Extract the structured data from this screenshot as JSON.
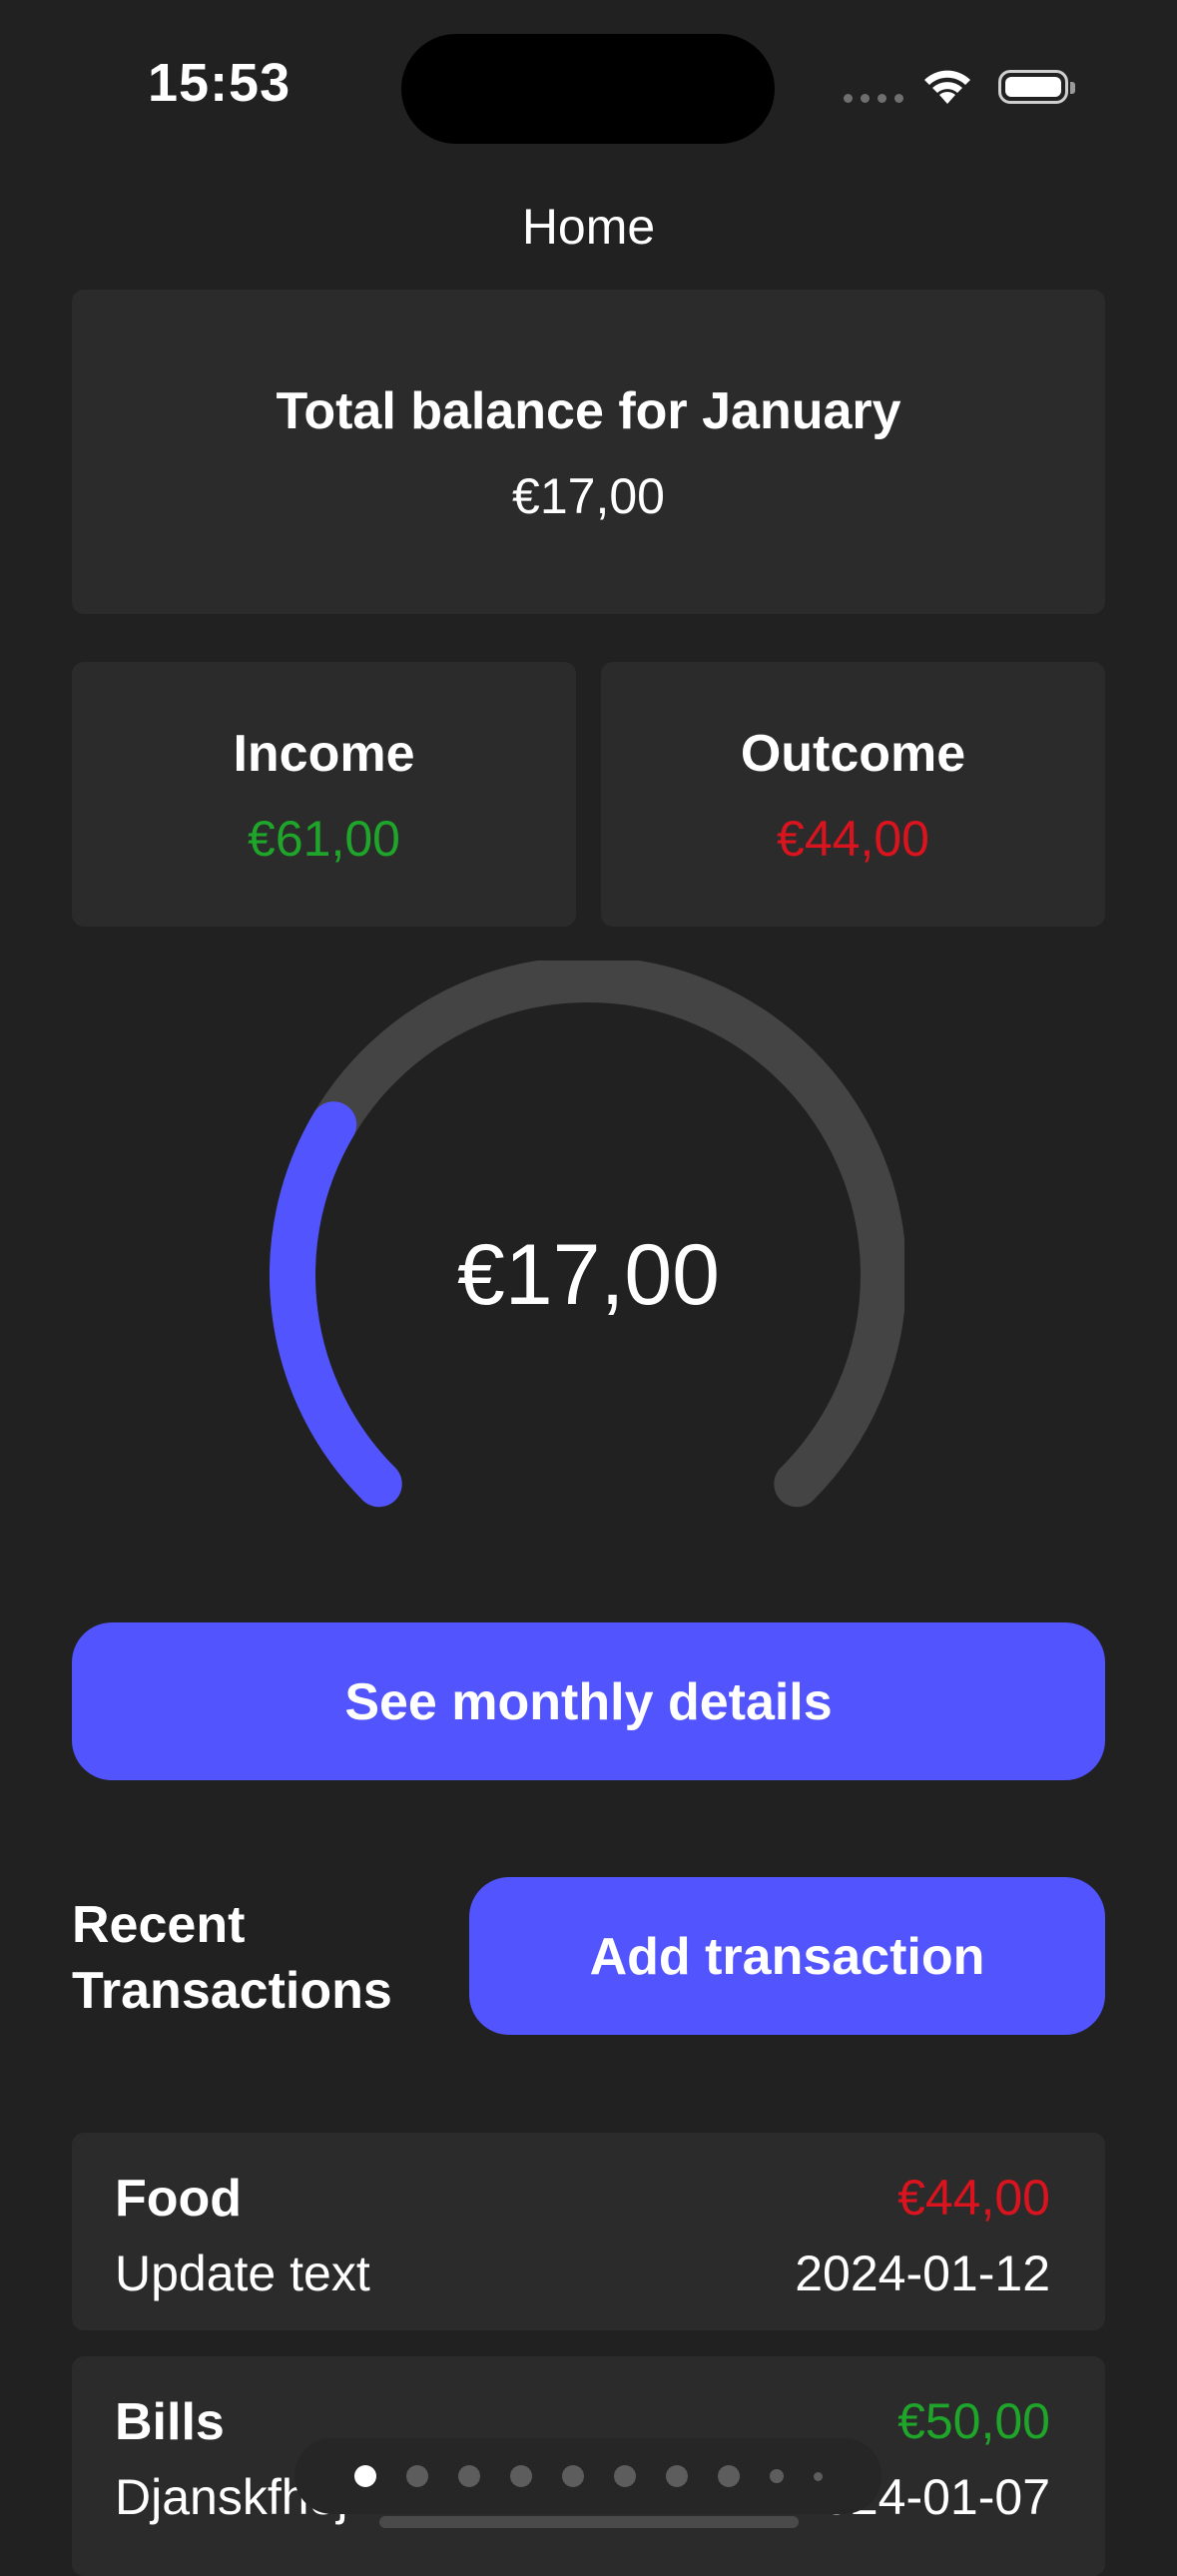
{
  "status_bar": {
    "time": "15:53"
  },
  "nav": {
    "title": "Home"
  },
  "balance": {
    "title": "Total balance for January",
    "amount": "€17,00"
  },
  "income": {
    "label": "Income",
    "value": "€61,00"
  },
  "outcome": {
    "label": "Outcome",
    "value": "€44,00"
  },
  "gauge": {
    "value": "€17,00",
    "progress": 0.28,
    "track_color": "#444444",
    "fill_color": "#5254fe"
  },
  "buttons": {
    "details": "See monthly details",
    "add": "Add transaction"
  },
  "recent": {
    "title": "Recent Transactions"
  },
  "transactions": [
    {
      "category": "Food",
      "amount": "€44,00",
      "note": "Update text",
      "date": "2024-01-12",
      "type": "outcome"
    },
    {
      "category": "Bills",
      "amount": "€50,00",
      "note": "Djanskfhej",
      "date": "2024-01-07",
      "type": "income"
    }
  ],
  "pager": {
    "pages": 10,
    "active": 0
  },
  "colors": {
    "accent": "#5254fe",
    "income": "#1ea52a",
    "outcome": "#d9141e",
    "background": "#212121",
    "card": "#2b2b2b"
  }
}
